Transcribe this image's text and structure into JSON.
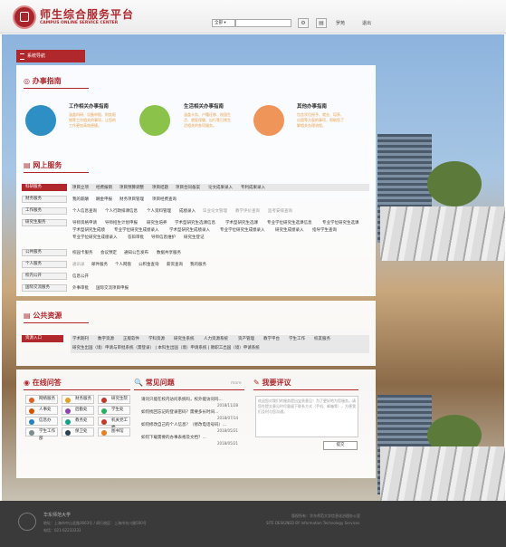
{
  "header": {
    "brand_cn": "师生综合服务平台",
    "brand_en": "CAMPUS ONLINE SERVICE CENTER",
    "search_select": "全部",
    "links": [
      "罗苑",
      "退出"
    ]
  },
  "nav": {
    "label": "系统导航"
  },
  "guide": {
    "title": "办事指南",
    "cards": [
      {
        "title": "工作相关办事指南",
        "desc": "涵盖科研、设备申报、财务报销等工作相关的事项，让您的工作更加高效便捷。"
      },
      {
        "title": "生活相关办事指南",
        "desc": "涵盖卡务、户籍迁移、校园生活、就医保健、出行等日常生活相关的各项服务。"
      },
      {
        "title": "其他办事指南",
        "desc": "包含学位授予、就业、培养、出国等方面的事项，帮助您了解相关办理流程。"
      }
    ]
  },
  "online": {
    "title": "网上服务",
    "rows": [
      {
        "label": "科研服务",
        "items": [
          "项目立项",
          "经费报销",
          "项目预算调整",
          "项目结题",
          "项目合同备案",
          "论文成果录入",
          "专利成果录入"
        ]
      },
      {
        "label": "财务服务",
        "items": [
          "我的薪酬",
          "酬金申报",
          "财务项目管理",
          "项目经费查询"
        ]
      },
      {
        "label": "工作服务",
        "items": [
          "个人信息查询",
          "个人行政排课信息",
          "个人资料管理",
          "成绩录入",
          "毕业论文管理",
          "教学评价查询",
          "监考安排查询"
        ]
      },
      {
        "label": "研究生服务",
        "items": [
          "导师资格申请",
          "导师招生计划申报",
          "研究生培养",
          "学术型研究生选课信息",
          "学术型研究生选课",
          "专业学位研究生选课信息",
          "专业学位研究生选课",
          "学术型研究生成绩",
          "专业学位研究生成绩录入",
          "学术型研究生成绩录入",
          "专业学位研究生成绩录入",
          "研究生成绩录入",
          "指导学生查询",
          "专业学位研究生成绩录入",
          "答辩审批",
          "导师信息维护",
          "研究生登记"
        ]
      },
      {
        "label": "公共服务",
        "items": [
          "校园卡服务",
          "会议预定",
          "通知公告发布",
          "数据共享服务"
        ]
      },
      {
        "label": "个人服务",
        "items": [
          "通讯录",
          "邮件服务",
          "个人网盘",
          "公积金查询",
          "薪资查询",
          "我的服务"
        ]
      },
      {
        "label": "校内公开",
        "items": [
          "信息公开"
        ]
      },
      {
        "label": "国际交流服务",
        "items": [
          "外事审批",
          "国际交流项目申报"
        ]
      }
    ]
  },
  "public": {
    "title": "公共资源",
    "label": "资源入口",
    "line1": [
      "学术期刊",
      "数字资源",
      "正版软件",
      "学科资源",
      "研究生系统",
      "人力资源系统",
      "资产管理",
      "教学平台",
      "学生工作",
      "校友服务"
    ],
    "line2": "研究生出国（境）申请与审批系统（需登录） | 本科生出国（境）申请系统 | 教职工出国（境）申请系统"
  },
  "qa": {
    "title": "在线问答",
    "buttons": [
      "网络服务",
      "财务服务",
      "研究生院",
      "人事处",
      "后勤处",
      "学生处",
      "信息办",
      "教务处",
      "机关党工委",
      "学生工作部",
      "保卫处",
      "图书馆"
    ]
  },
  "faq": {
    "title": "常见问题",
    "more": "more",
    "items": [
      {
        "q": "请问只能在校内访问系统吗，校外能访问吗...",
        "d": "2018/11/28"
      },
      {
        "q": "如何找回忘记的登录密码？需要多长时间...",
        "d": "2018/07/14"
      },
      {
        "q": "如何修改自己的个人信息？（修改电话号码）...",
        "d": "2018/05/21"
      },
      {
        "q": "如何下载需要的办事表格及文档？...",
        "d": "2018/05/21"
      }
    ]
  },
  "review": {
    "title": "我要评议",
    "placeholder": "欢迎您对我们的服务提出宝贵意见！为了更好地为您服务，请您在提交意见时尽量留下联系方式（手机、邮箱等），方便我们及时与您沟通。",
    "submit": "提交"
  },
  "footer": {
    "org": "华东师范大学",
    "addr": "地址：上海市中山北路3663号 / 闵行校区：上海市东川路500号",
    "phone": "电话：021-62233333",
    "copy": "版权所有：华东师范大学信息化治理办公室",
    "designer": "SITE DESIGNED BY Information Technology Services"
  }
}
